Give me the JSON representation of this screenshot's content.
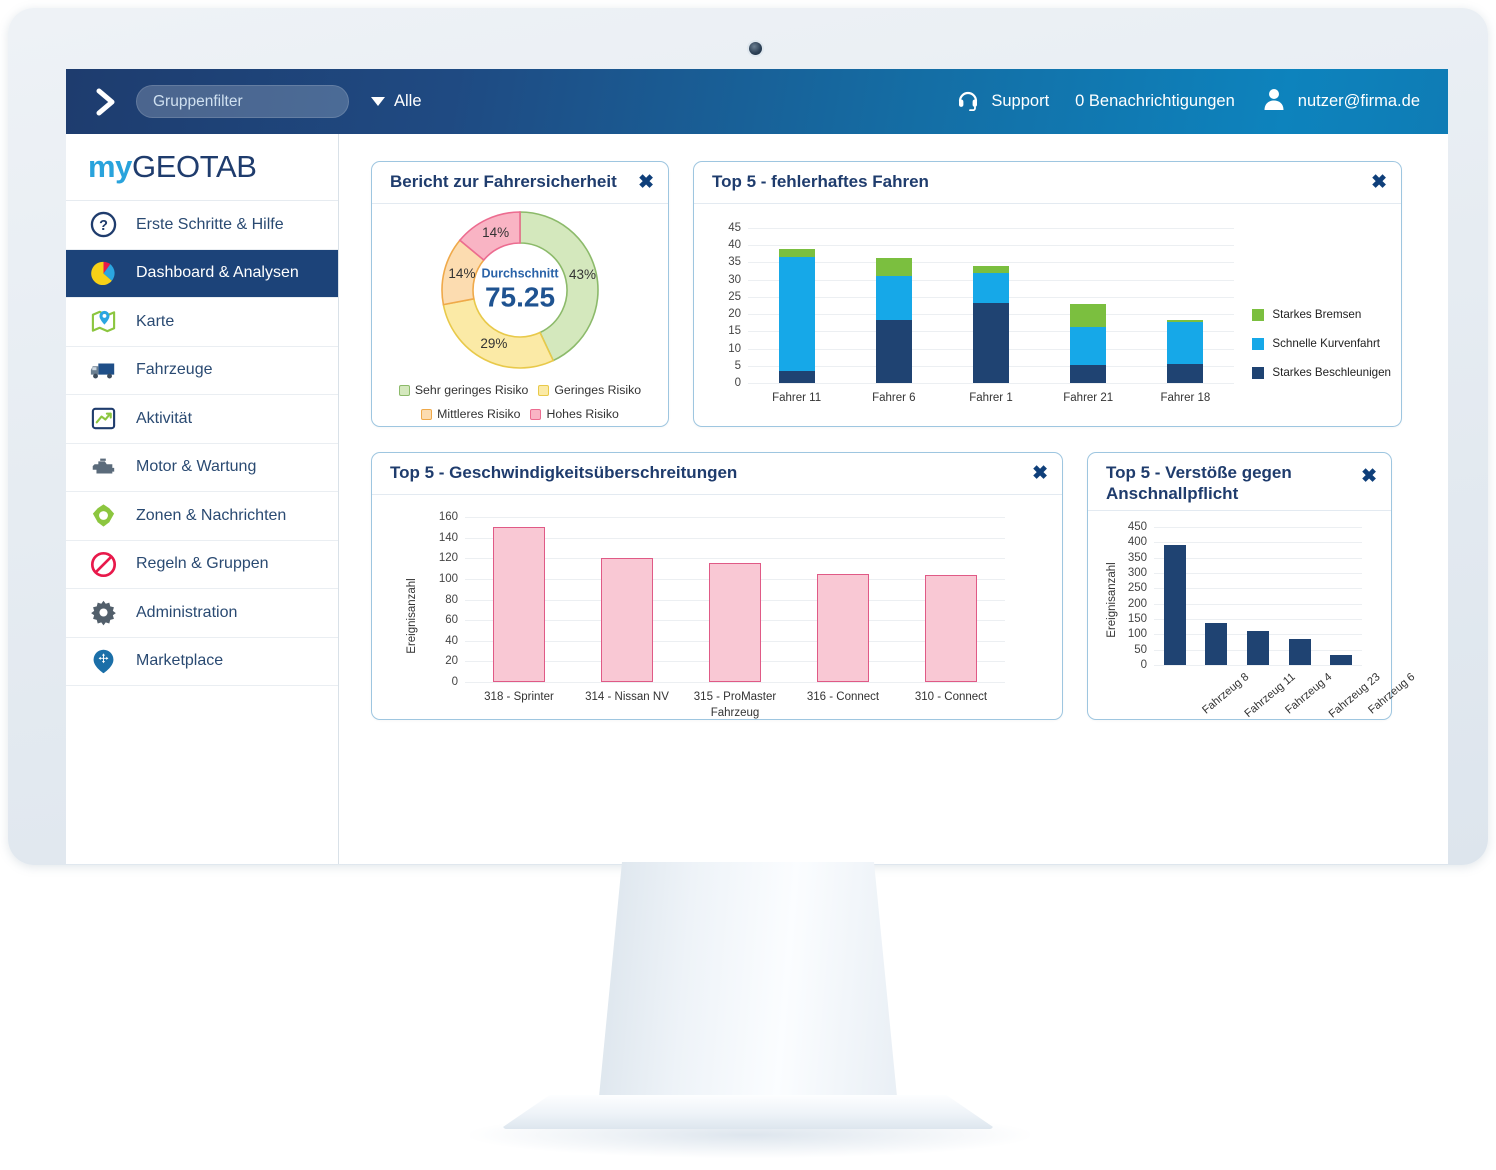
{
  "topbar": {
    "chevron_icon": "chevron-right-icon",
    "group_filter_placeholder": "Gruppenfilter",
    "group_filter_value": "",
    "dropdown_label": "Alle",
    "support_label": "Support",
    "notifications_label": "0 Benachrichtigungen",
    "user_email": "nutzer@firma.de",
    "headset_icon": "headset-icon",
    "user_icon": "user-avatar-icon"
  },
  "brand": {
    "part1": "my",
    "part2": "GEOTAB"
  },
  "sidebar": {
    "items": [
      {
        "label": "Erste Schritte & Hilfe",
        "icon": "question-circle-icon",
        "active": false
      },
      {
        "label": "Dashboard & Analysen",
        "icon": "pie-chart-icon",
        "active": true
      },
      {
        "label": "Karte",
        "icon": "map-pin-icon",
        "active": false
      },
      {
        "label": "Fahrzeuge",
        "icon": "truck-icon",
        "active": false
      },
      {
        "label": "Aktivität",
        "icon": "activity-graph-icon",
        "active": false
      },
      {
        "label": "Motor & Wartung",
        "icon": "engine-icon",
        "active": false
      },
      {
        "label": "Zonen & Nachrichten",
        "icon": "zone-star-icon",
        "active": false
      },
      {
        "label": "Regeln & Gruppen",
        "icon": "prohibited-icon",
        "active": false
      },
      {
        "label": "Administration",
        "icon": "gear-icon",
        "active": false
      },
      {
        "label": "Marketplace",
        "icon": "marketplace-pin-icon",
        "active": false
      }
    ]
  },
  "cards": {
    "safety": {
      "title": "Bericht zur Fahrersicherheit",
      "close": "✖"
    },
    "faulty": {
      "title": "Top 5 - fehlerhaftes Fahren",
      "close": "✖"
    },
    "speed": {
      "title": "Top 5 -  Geschwindigkeitsüberschreitungen",
      "close": "✖"
    },
    "belt": {
      "title": "Top 5 - Verstöße gegen Anschnallpflicht",
      "close": "✖"
    }
  },
  "chart_data": [
    {
      "id": "driver_safety_donut",
      "type": "pie",
      "title": "Bericht zur Fahrersicherheit",
      "center_label": "Durchschnitt",
      "center_value": "75.25",
      "categories": [
        "Sehr geringes Risiko",
        "Geringes Risiko",
        "Mittleres Risiko",
        "Hohes Risiko"
      ],
      "values": [
        43,
        29,
        14,
        14
      ],
      "value_labels": [
        "43%",
        "29%",
        "14%",
        "14%"
      ],
      "colors": [
        "#d4e8bd",
        "#fbeaa6",
        "#fcdcb0",
        "#f9b4c4"
      ],
      "border_colors": [
        "#8cba6a",
        "#e8c94a",
        "#efa94a",
        "#ec6c90"
      ],
      "legend_position": "bottom",
      "unit": "%"
    },
    {
      "id": "faulty_driving_stacked",
      "type": "bar",
      "stacked": true,
      "title": "Top 5 - fehlerhaftes Fahren",
      "categories": [
        "Fahrer 11",
        "Fahrer 6",
        "Fahrer 1",
        "Fahrer 21",
        "Fahrer 18"
      ],
      "series": [
        {
          "name": "Starkes Beschleunigen",
          "color": "#1f4372",
          "values": [
            3.6,
            18.3,
            23.1,
            5.2,
            5.6
          ]
        },
        {
          "name": "Schnelle Kurvenfahrt",
          "color": "#16a8e8",
          "values": [
            32.9,
            12.8,
            8.7,
            11.0,
            12.1
          ]
        },
        {
          "name": "Starkes Bremsen",
          "color": "#7bbf3f",
          "values": [
            2.3,
            5.1,
            2.2,
            6.6,
            0.7
          ]
        }
      ],
      "legend_order": [
        "Starkes Bremsen",
        "Schnelle Kurvenfahrt",
        "Starkes Beschleunigen"
      ],
      "ylim": [
        0,
        45
      ],
      "yticks": [
        0,
        5,
        10,
        15,
        20,
        25,
        30,
        35,
        40,
        45
      ],
      "xlabel": "",
      "ylabel": "",
      "grid": true,
      "legend_position": "right"
    },
    {
      "id": "speeding_bar",
      "type": "bar",
      "title": "Top 5 -  Geschwindigkeitsüberschreitungen",
      "categories": [
        "318 - Sprinter",
        "314 - Nissan NV",
        "315 - ProMaster",
        "316 - Connect",
        "310 - Connect"
      ],
      "values": [
        150,
        120,
        115,
        105,
        104
      ],
      "bar_color": "#f9c8d4",
      "bar_border": "#e05a86",
      "ylim": [
        0,
        160
      ],
      "yticks": [
        0,
        20,
        40,
        60,
        80,
        100,
        120,
        140,
        160
      ],
      "xlabel": "Fahrzeug",
      "ylabel": "Ereignisanzahl",
      "grid": true
    },
    {
      "id": "seatbelt_bar",
      "type": "bar",
      "title": "Top 5 - Verstöße gegen Anschnallpflicht",
      "categories": [
        "Fahrzeug 8",
        "Fahrzeug 11",
        "Fahrzeug 4",
        "Fahrzeug 23",
        "Fahrzeug 6"
      ],
      "values": [
        390,
        137,
        110,
        85,
        32
      ],
      "bar_color": "#1f4372",
      "ylim": [
        0,
        450
      ],
      "yticks": [
        0,
        50,
        100,
        150,
        200,
        250,
        300,
        350,
        400,
        450
      ],
      "xlabel": "",
      "ylabel": "Ereignisanzahl",
      "grid": true
    }
  ],
  "colors": {
    "brand_blue": "#29a3dc",
    "brand_navy": "#1f3c6d",
    "topbar_from": "#1e3c6e",
    "topbar_to": "#0d83bd",
    "sidebar_active": "#1c4379",
    "card_border": "#9ec6e0"
  }
}
